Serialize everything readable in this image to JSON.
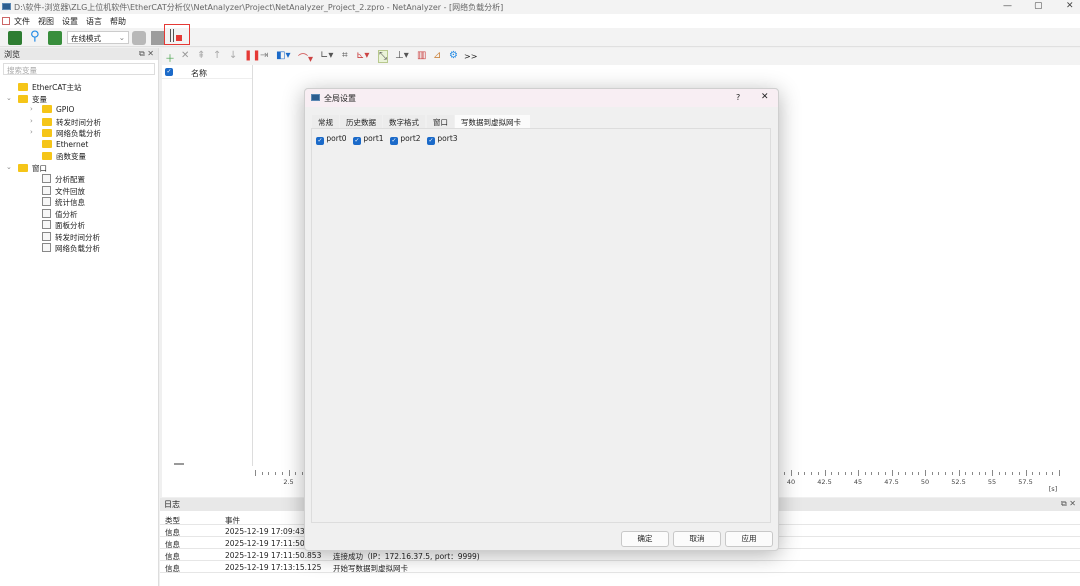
{
  "window": {
    "title": "D:\\软件-浏览器\\ZLG上位机软件\\EtherCAT分析仪\\NetAnalyzer\\Project\\NetAnalyzer_Project_2.zpro - NetAnalyzer - [网络负载分析]",
    "controls": [
      "—",
      "▢",
      "✕"
    ]
  },
  "menu": [
    "文件",
    "视图",
    "设置",
    "语言",
    "帮助"
  ],
  "toolbar": {
    "mode": "在线模式"
  },
  "browse": {
    "title": "浏览",
    "search_placeholder": "搜索变量",
    "tree": [
      {
        "label": "EtherCAT主站",
        "type": "folder",
        "level": 0
      },
      {
        "label": "变量",
        "type": "folder",
        "level": 0,
        "expanded": true
      },
      {
        "label": "GPIO",
        "type": "folder",
        "level": 1,
        "collapsed": true
      },
      {
        "label": "转发时间分析",
        "type": "folder",
        "level": 1,
        "collapsed": true
      },
      {
        "label": "网络负载分析",
        "type": "folder",
        "level": 1,
        "collapsed": true
      },
      {
        "label": "Ethernet",
        "type": "folder",
        "level": 1
      },
      {
        "label": "函数变量",
        "type": "folder",
        "level": 1
      },
      {
        "label": "窗口",
        "type": "folder",
        "level": 0,
        "expanded": true
      },
      {
        "label": "分析配置",
        "type": "window",
        "level": 1
      },
      {
        "label": "文件回放",
        "type": "window",
        "level": 1
      },
      {
        "label": "统计信息",
        "type": "window",
        "level": 1
      },
      {
        "label": "值分析",
        "type": "window",
        "level": 1
      },
      {
        "label": "面板分析",
        "type": "window",
        "level": 1
      },
      {
        "label": "转发时间分析",
        "type": "window",
        "level": 1
      },
      {
        "label": "网络负载分析",
        "type": "window",
        "level": 1
      }
    ]
  },
  "varlist": {
    "column": "名称"
  },
  "chart": {
    "tick_labels": [
      {
        "v": 2.5,
        "t": "2.5"
      },
      {
        "v": 40,
        "t": "40"
      },
      {
        "v": 42.5,
        "t": "42.5"
      },
      {
        "v": 45,
        "t": "45"
      },
      {
        "v": 47.5,
        "t": "47.5"
      },
      {
        "v": 50,
        "t": "50"
      },
      {
        "v": 52.5,
        "t": "52.5"
      },
      {
        "v": 55,
        "t": "55"
      },
      {
        "v": 57.5,
        "t": "57.5"
      }
    ],
    "unit": "[s]"
  },
  "log": {
    "title": "日志",
    "columns": [
      "类型",
      "事件"
    ],
    "rows": [
      {
        "type": "信息",
        "time": "2025-12-19 17:09:43.3",
        "event": ""
      },
      {
        "type": "信息",
        "time": "2025-12-19 17:11:50.7",
        "event": ""
      },
      {
        "type": "信息",
        "time": "2025-12-19 17:11:50.853",
        "event": "连接成功（IP：172.16.37.5, port：9999)"
      },
      {
        "type": "信息",
        "time": "2025-12-19 17:13:15.125",
        "event": "开始写数据到虚拟网卡"
      }
    ]
  },
  "dialog": {
    "title": "全局设置",
    "help": "?",
    "close": "✕",
    "tabs": [
      "常规",
      "历史数据",
      "数字格式",
      "窗口",
      "写数据到虚拟网卡"
    ],
    "active_tab": 4,
    "ports": [
      {
        "label": "port0",
        "checked": true
      },
      {
        "label": "port1",
        "checked": true
      },
      {
        "label": "port2",
        "checked": true
      },
      {
        "label": "port3",
        "checked": true
      }
    ],
    "buttons": {
      "ok": "确定",
      "cancel": "取消",
      "apply": "应用"
    }
  },
  "colors": {
    "accent": "#1b6ac9",
    "highlight": "#e53935",
    "folder": "#f5c518"
  }
}
